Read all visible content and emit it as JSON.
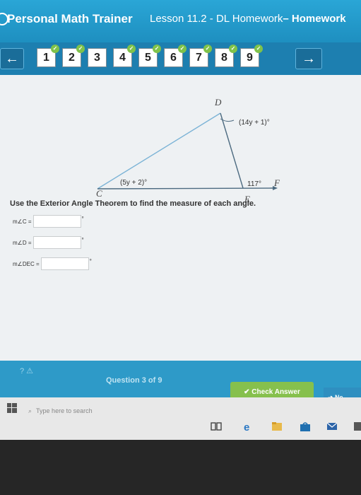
{
  "header": {
    "brand": "Personal Math Trainer",
    "lesson_prefix": "Lesson 11.2 - DL Homework",
    "lesson_suffix": "– Homework"
  },
  "nav": {
    "prev_icon": "left-arrow-icon",
    "next_icon": "right-arrow-icon",
    "questions": [
      "1",
      "2",
      "3",
      "4",
      "5",
      "6",
      "7",
      "8",
      "9"
    ],
    "current": "3"
  },
  "diagram": {
    "vertex_d": "D",
    "vertex_c": "C",
    "vertex_e": "E",
    "point_f": "F",
    "angle_d": "(14y + 1)°",
    "angle_c": "(5y + 2)°",
    "angle_exterior": "117°"
  },
  "problem": {
    "instructions": "Use the Exterior Angle Theorem to find the measure of each angle.",
    "answers": [
      {
        "label": "m∠C =",
        "value": "",
        "unit": "°"
      },
      {
        "label": "m∠D =",
        "value": "",
        "unit": "°"
      },
      {
        "label": "m∠DEC =",
        "value": "",
        "unit": "°"
      }
    ]
  },
  "footer": {
    "help": "? ⚠",
    "question_count": "Question 3 of 9",
    "check_answer": "✔ Check Answer",
    "next": "Ne"
  },
  "taskbar": {
    "search_placeholder": "Type here to search"
  },
  "colors": {
    "header": "#2aa6d6",
    "nav": "#1d7fb0",
    "check_button": "#86c04d",
    "footer": "#2e9ac8"
  }
}
